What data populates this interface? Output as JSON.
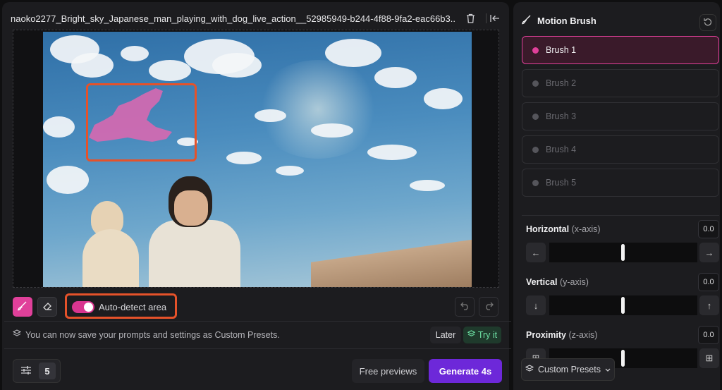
{
  "file": {
    "name": "naoko2277_Bright_sky_Japanese_man_playing_with_dog_live_action__52985949-b244-4f88-9fa2-eac66b3...",
    "delete_icon": "trash-icon",
    "collapse_icon": "collapse-left-icon"
  },
  "toolbar": {
    "brush_icon": "brush-icon",
    "eraser_icon": "eraser-icon",
    "auto_detect_label": "Auto-detect area",
    "auto_detect_on": true,
    "undo_icon": "undo-icon",
    "redo_icon": "redo-icon"
  },
  "notice": {
    "message": "You can now save your prompts and settings as Custom Presets.",
    "later_label": "Later",
    "try_label": "Try it"
  },
  "footer": {
    "count": "5",
    "free_previews_label": "Free previews",
    "generate_label": "Generate 4s"
  },
  "motion_brush": {
    "title": "Motion Brush",
    "brushes": [
      {
        "label": "Brush 1",
        "active": true
      },
      {
        "label": "Brush 2",
        "active": false
      },
      {
        "label": "Brush 3",
        "active": false
      },
      {
        "label": "Brush 4",
        "active": false
      },
      {
        "label": "Brush 5",
        "active": false
      }
    ],
    "axes": [
      {
        "label": "Horizontal",
        "sub": "(x-axis)",
        "value": "0.0",
        "left_icon": "←",
        "right_icon": "→"
      },
      {
        "label": "Vertical",
        "sub": "(y-axis)",
        "value": "0.0",
        "left_icon": "↓",
        "right_icon": "↑"
      },
      {
        "label": "Proximity",
        "sub": "(z-axis)",
        "value": "0.0",
        "left_icon": "⊞",
        "right_icon": "⊞"
      }
    ],
    "custom_presets_label": "Custom Presets"
  },
  "colors": {
    "accent_pink": "#e0409a",
    "generate_purple": "#6d28d9",
    "highlight_red": "#e5522a",
    "try_green": "#6fe3a6"
  }
}
